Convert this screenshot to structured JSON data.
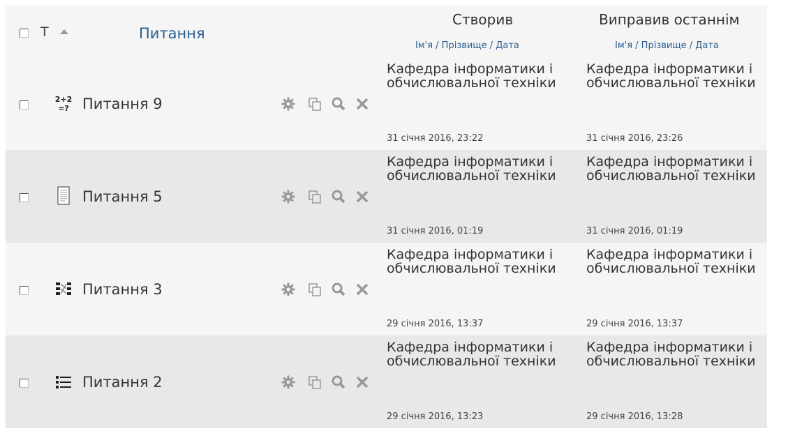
{
  "header": {
    "type_label": "Т",
    "question_label": "Питання",
    "created_label": "Створив",
    "modified_label": "Виправив останнім",
    "name_sort_links": "Ім'я / Прізвище / Дата"
  },
  "rows": [
    {
      "name": "Питання 9",
      "icon": "calculated-question-icon",
      "created_by": "Кафедра інформатики і обчислювальної техніки",
      "created_date": "31 січня 2016, 23:22",
      "modified_by": "Кафедра інформатики і обчислювальної техніки",
      "modified_date": "31 січня 2016, 23:26"
    },
    {
      "name": "Питання 5",
      "icon": "essay-question-icon",
      "created_by": "Кафедра інформатики і обчислювальної техніки",
      "created_date": "31 січня 2016, 01:19",
      "modified_by": "Кафедра інформатики і обчислювальної техніки",
      "modified_date": "31 січня 2016, 01:19"
    },
    {
      "name": "Питання 3",
      "icon": "matching-question-icon",
      "created_by": "Кафедра інформатики і обчислювальної техніки",
      "created_date": "29 січня 2016, 13:37",
      "modified_by": "Кафедра інформатики і обчислювальної техніки",
      "modified_date": "29 січня 2016, 13:37"
    },
    {
      "name": "Питання 2",
      "icon": "multichoice-question-icon",
      "created_by": "Кафедра інформатики і обчислювальної техніки",
      "created_date": "29 січня 2016, 13:23",
      "modified_by": "Кафедра інформатики і обчислювальної техніки",
      "modified_date": "29 січня 2016, 13:28"
    }
  ],
  "actions": [
    "gear-icon",
    "duplicate-icon",
    "preview-icon",
    "delete-icon"
  ],
  "colors": {
    "link": "#2a5d8f",
    "icon_gray": "#999999",
    "row_alt": "#e8e8e8",
    "row": "#f5f5f5"
  }
}
